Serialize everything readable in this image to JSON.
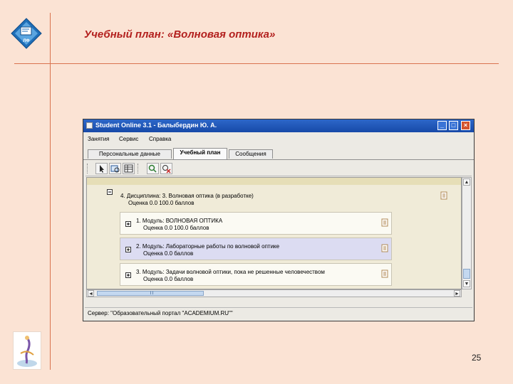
{
  "slide": {
    "title": "Учебный план: «Волновая оптика»",
    "page_number": "25",
    "logo_label": "ЛФ"
  },
  "window": {
    "title": "Student Online 3.1 - Балыбердин Ю. А.",
    "controls": {
      "minimize": "_",
      "maximize": "□",
      "close": "×"
    }
  },
  "menu": [
    "Занятия",
    "Сервис",
    "Справка"
  ],
  "tabs": [
    {
      "label": "Персональные данные",
      "active": false
    },
    {
      "label": "Учебный план",
      "active": true
    },
    {
      "label": "Сообщения",
      "active": false
    }
  ],
  "toolbar": {
    "buttons": [
      "pointer-icon",
      "module-view-icon",
      "grid-view-icon",
      "search-add-icon",
      "delete-icon"
    ]
  },
  "discipline": {
    "toggle": "−",
    "line1": "4. Дисциплина: 3. Волновая оптика (в разработке)",
    "line2": "Оценка 0.0   100.0 баллов"
  },
  "modules": [
    {
      "toggle": "+",
      "line1": "1. Модуль: ВОЛНОВАЯ ОПТИКА",
      "line2": "Оценка 0.0   100.0 баллов",
      "selected": false
    },
    {
      "toggle": "+",
      "line1": "2. Модуль: Лабораторные работы по волновой оптике",
      "line2": "Оценка 0.0 баллов",
      "selected": true
    },
    {
      "toggle": "+",
      "line1": "3. Модуль: Задачи волновой оптики, пока не решенные человечеством",
      "line2": "Оценка 0.0 баллов",
      "selected": false
    }
  ],
  "scroll": {
    "up": "▲",
    "down": "▼",
    "left": "◄",
    "right": "►"
  },
  "statusbar": {
    "text": "Сервер: \"Образовательный портал \"ACADEMIUM.RU\"\""
  }
}
